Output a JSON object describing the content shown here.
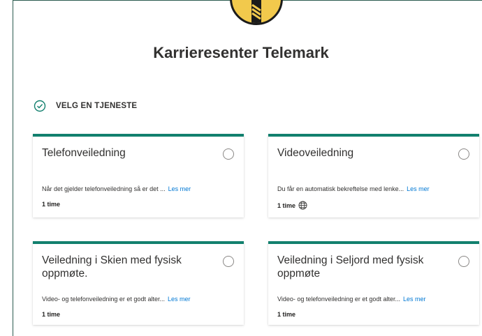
{
  "page": {
    "title": "Karrieresenter Telemark",
    "section_label": "VELG EN TJENESTE"
  },
  "services": [
    {
      "name": "Telefonveiledning",
      "description": "Når det gjelder telefonveiledning så er det ...",
      "more": "Les mer",
      "duration": "1 time"
    },
    {
      "name": "Videoveiledning",
      "description": "Du får en automatisk bekreftelse med lenke...",
      "more": "Les mer",
      "duration": "1 time"
    },
    {
      "name": "Veiledning i Skien med fysisk oppmøte.",
      "description": "Video- og telefonveiledning er et godt alter...",
      "more": "Les mer",
      "duration": "1 time"
    },
    {
      "name": "Veiledning i Seljord med fysisk oppmøte",
      "description": "Video- og telefonveiledning er et godt alter...",
      "more": "Les mer",
      "duration": "1 time"
    }
  ],
  "colors": {
    "accent": "#12806e",
    "link": "#0078d4",
    "logo": "#f2c94c"
  },
  "icons": {
    "section": "check-circle-icon",
    "online": "globe-icon"
  }
}
